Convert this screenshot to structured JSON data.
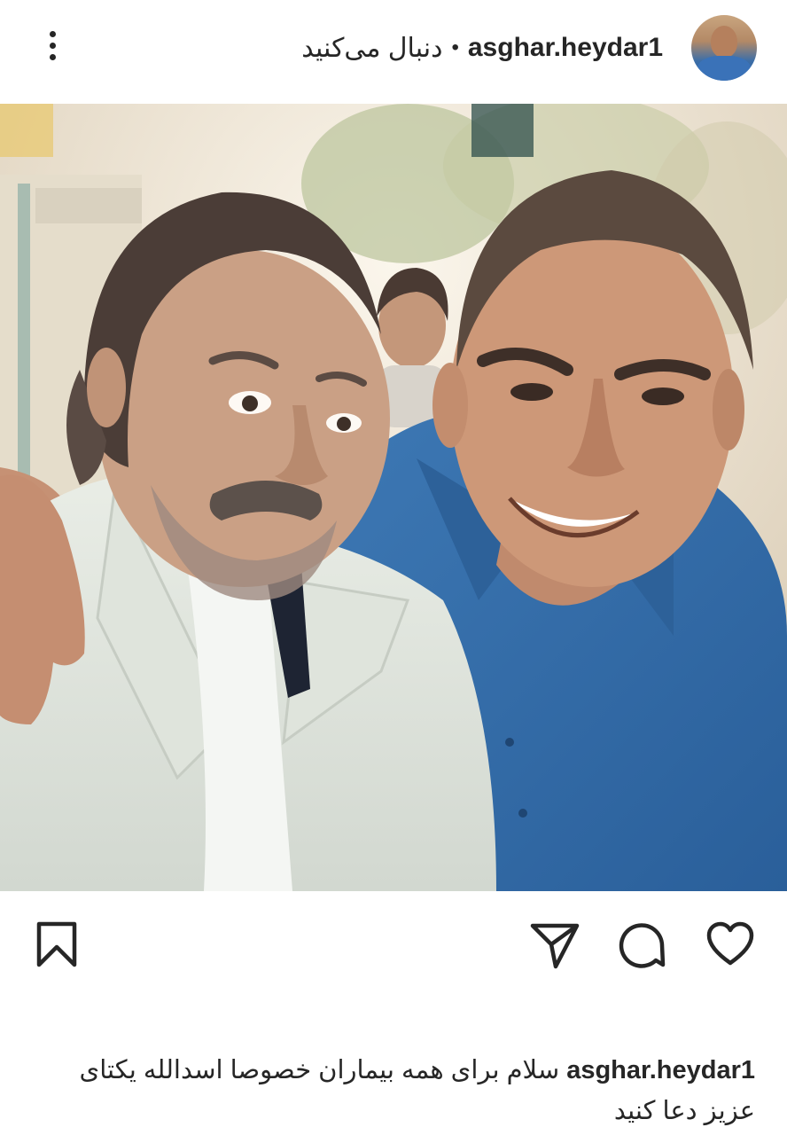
{
  "header": {
    "username": "asghar.heydar1",
    "separator": "•",
    "follow_label": "دنبال می‌کنید",
    "more_icon": "more-vertical-icon",
    "avatar_icon": "avatar"
  },
  "post": {
    "image_alt": "photo"
  },
  "actions": {
    "like_icon": "heart-icon",
    "comment_icon": "comment-icon",
    "share_icon": "send-icon",
    "save_icon": "bookmark-icon"
  },
  "caption": {
    "username": "asghar.heydar1",
    "text": "سلام برای همه بیماران خصوصا اسدالله یکتای عزیز دعا کنید"
  },
  "colors": {
    "text": "#262626",
    "background": "#ffffff"
  }
}
